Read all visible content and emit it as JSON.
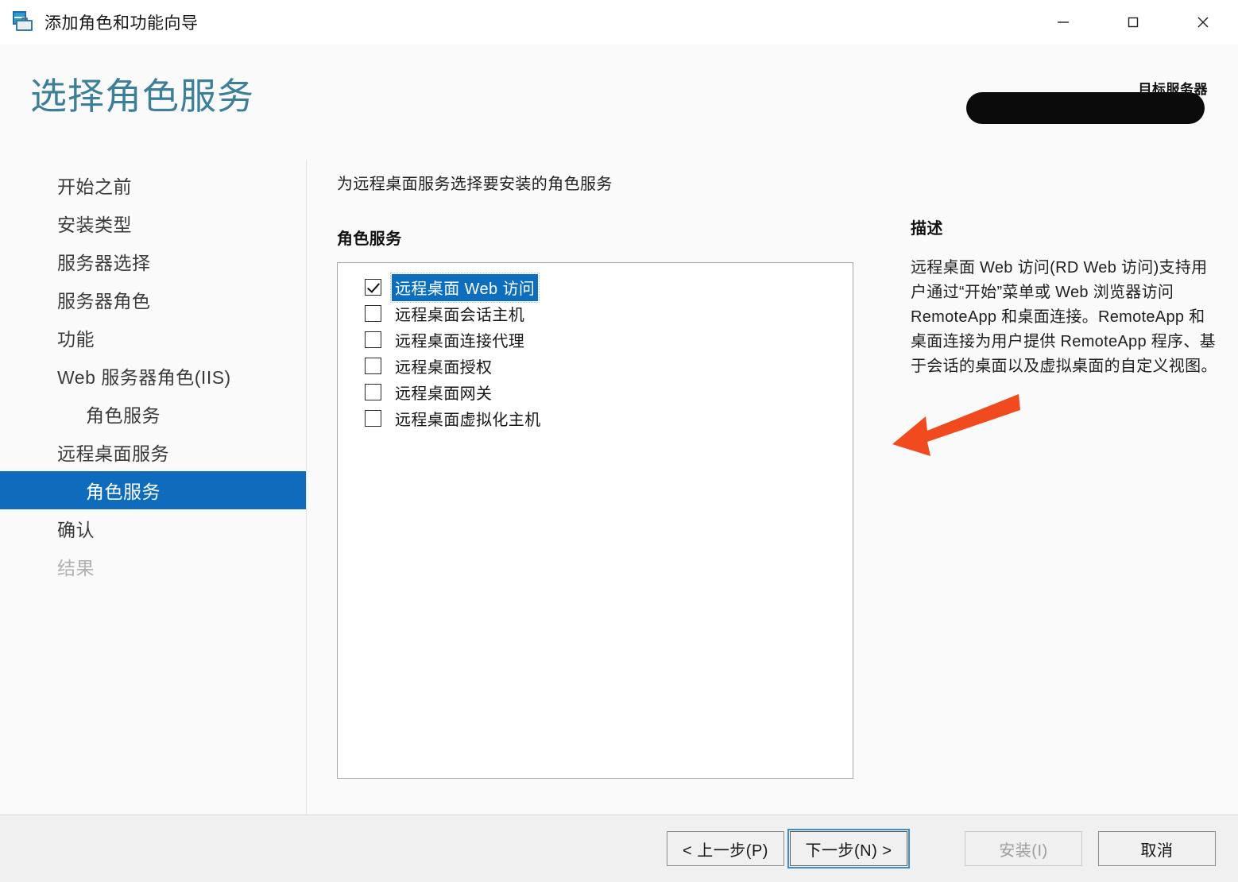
{
  "window": {
    "title": "添加角色和功能向导",
    "app_icon": "server-toolbox-icon",
    "minimize": "minimize-icon",
    "maximize": "maximize-icon",
    "close": "close-icon"
  },
  "header": {
    "page_title": "选择角色服务",
    "target_server_label": "目标服务器",
    "target_server_value": "",
    "title_color": "#3c7f96"
  },
  "sidebar": {
    "items": [
      {
        "label": "开始之前",
        "indent": false,
        "selected": false,
        "disabled": false
      },
      {
        "label": "安装类型",
        "indent": false,
        "selected": false,
        "disabled": false
      },
      {
        "label": "服务器选择",
        "indent": false,
        "selected": false,
        "disabled": false
      },
      {
        "label": "服务器角色",
        "indent": false,
        "selected": false,
        "disabled": false
      },
      {
        "label": "功能",
        "indent": false,
        "selected": false,
        "disabled": false
      },
      {
        "label": "Web 服务器角色(IIS)",
        "indent": false,
        "selected": false,
        "disabled": false
      },
      {
        "label": "角色服务",
        "indent": true,
        "selected": false,
        "disabled": false
      },
      {
        "label": "远程桌面服务",
        "indent": false,
        "selected": false,
        "disabled": false
      },
      {
        "label": "角色服务",
        "indent": true,
        "selected": true,
        "disabled": false
      },
      {
        "label": "确认",
        "indent": false,
        "selected": false,
        "disabled": false
      },
      {
        "label": "结果",
        "indent": false,
        "selected": false,
        "disabled": true
      }
    ],
    "selected_bg": "#0f6cbd"
  },
  "main": {
    "instruction": "为远程桌面服务选择要安装的角色服务",
    "section_heading": "角色服务",
    "role_services": [
      {
        "label": "远程桌面 Web 访问",
        "checked": true,
        "selected": true
      },
      {
        "label": "远程桌面会话主机",
        "checked": false,
        "selected": false
      },
      {
        "label": "远程桌面连接代理",
        "checked": false,
        "selected": false
      },
      {
        "label": "远程桌面授权",
        "checked": false,
        "selected": false
      },
      {
        "label": "远程桌面网关",
        "checked": false,
        "selected": false
      },
      {
        "label": "远程桌面虚拟化主机",
        "checked": false,
        "selected": false
      }
    ],
    "selection_highlight": "#0c6ebd"
  },
  "description": {
    "heading": "描述",
    "text": "远程桌面 Web 访问(RD Web 访问)支持用户通过“开始”菜单或 Web 浏览器访问 RemoteApp 和桌面连接。RemoteApp 和桌面连接为用户提供 RemoteApp 程序、基于会话的桌面以及虚拟桌面的自定义视图。"
  },
  "annotation": {
    "arrow": "arrow-pointing-left",
    "color": "#F04A1E"
  },
  "footer": {
    "previous": "< 上一步(P)",
    "next": "下一步(N) >",
    "install": "安装(I)",
    "cancel": "取消",
    "install_disabled": true,
    "next_focused": true
  }
}
